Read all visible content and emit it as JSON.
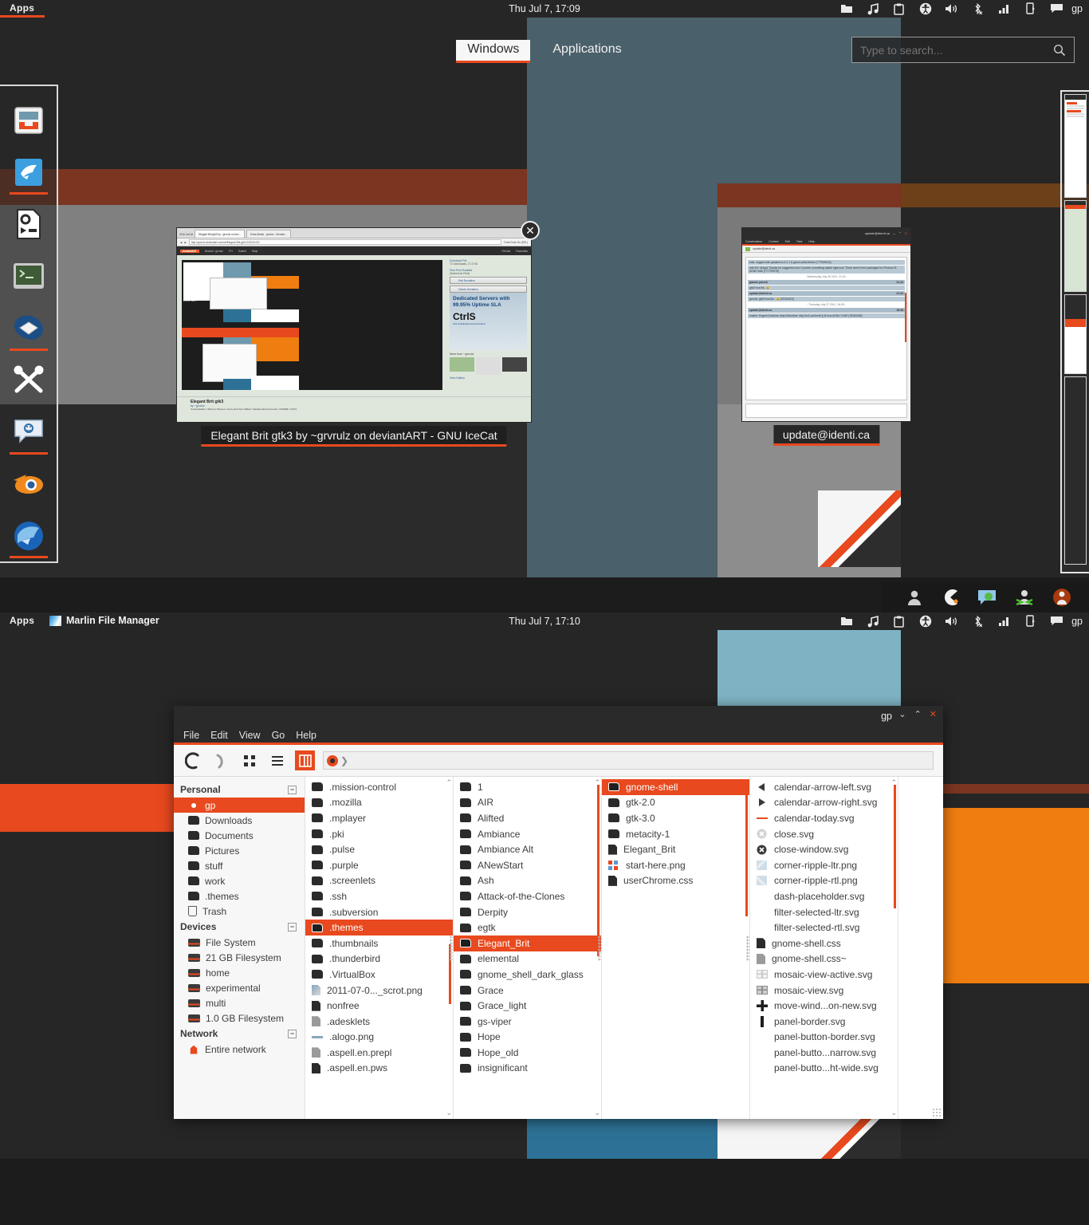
{
  "top_screen": {
    "panel": {
      "apps_label": "Apps",
      "clock": "Thu Jul 7, 17:09",
      "username": "gp",
      "tray_icons": [
        "folder-icon",
        "music-icon",
        "clipboard-icon",
        "accessibility-icon",
        "volume-icon",
        "bluetooth-disabled-icon",
        "signal-icon",
        "battery-icon",
        "chat-icon"
      ]
    },
    "overview": {
      "tabs": [
        {
          "label": "Windows",
          "active": true
        },
        {
          "label": "Applications",
          "active": false
        }
      ],
      "search_placeholder": "Type to search...",
      "search_value": "",
      "search_icon": "search-icon"
    },
    "dock": {
      "items": [
        {
          "name": "file-manager",
          "running": false
        },
        {
          "name": "icecat-browser",
          "running": true
        },
        {
          "name": "script-executor",
          "running": false
        },
        {
          "name": "terminal",
          "running": false
        },
        {
          "name": "thunderbird",
          "running": true
        },
        {
          "name": "xchat-scissors",
          "running": false
        },
        {
          "name": "empathy-chat",
          "running": true
        },
        {
          "name": "blender",
          "running": false
        },
        {
          "name": "firefox-blue",
          "running": true
        }
      ]
    },
    "window_previews": [
      {
        "label": "Elegant Brit gtk3 by ~grvrulz on deviantART - GNU IceCat",
        "has_close": true,
        "browser": {
          "app_tab": "GNU IceCat",
          "tabs": [
            "Elegant Brit gtk3 by ~grvrulz on dev...",
            "Extra Media - photos - Deviant..."
          ],
          "url": "http://grvrulz.deviantart.com/art/Elegant-Brit-gtk3-249412432",
          "search_engine": "Duck Duck Go (SSL)",
          "nav_items": [
            "deviantART",
            "Deviant ~grvrulz",
            "FYI",
            "Submit",
            "Shop"
          ],
          "nav_right": [
            "Friends",
            "Favourites"
          ],
          "side_links": [
            "Download File",
            "72 downloads, 27.2 KB",
            "Print Print Enabled",
            "(Submit as Print)"
          ],
          "side_buttons": [
            "Edit Deviation",
            "Delete Deviation"
          ],
          "ad_title": "Dedicated Servers with 99.95% Uptime SLA",
          "ad_brand": "CtrlS",
          "ad_sub1": "ctrls.in/dedicated-servers-india.in",
          "ad_sub2": "To Check Offer Click Here to Know",
          "ad_footer": "Ctrls.in Dedicated Hosting Servers",
          "more_from": "More from ~grvrulz",
          "gallery_link": "View Gallery",
          "art_title": "Elegant Brit gtk3",
          "art_by": "by ~grvrulz",
          "art_cats": "Customisation / Skins & Themes / Linux and Unix Utilities / Desktop Environments / GNOME / GTK3",
          "art_copy": "©2011 ~grvrulz",
          "art_caption": "free a..."
        }
      },
      {
        "label": "update@identi.ca",
        "has_close": false,
        "chat": {
          "title": "update@identi.ca",
          "menus": [
            "Conversation",
            "Contact",
            "Edit",
            "Tabs",
            "Help"
          ],
          "tab_label": "update@identi.ca",
          "messages": [
            {
              "type": "text",
              "body": "mks: oxygen-kde updated to 4.2.1 & gdm4-ar5ul firefox (777939042)"
            },
            {
              "type": "text",
              "body": "w4rr10r: @apol Thanks for suggestion but I'd prefer something stable right now. There aren't even packages for !Fedora 15 AFAIK !kde [777793978]"
            },
            {
              "type": "date",
              "body": "- Wednesday July 06 2011, 21:24 -"
            },
            {
              "type": "header",
              "from": "gaurav pareek",
              "time": "21:24"
            },
            {
              "type": "body",
              "body": "gtk3+css ftw.. 😃"
            },
            {
              "type": "header",
              "from": "update@identi.ca",
              "time": "21:24"
            },
            {
              "type": "body",
              "body": "grvrulz: gtk3+css ftw.. 😃 [78190023]"
            },
            {
              "type": "date",
              "body": "- Thursday July 07 2011, 16:28 -"
            },
            {
              "type": "header",
              "from": "update@identi.ca",
              "time": "16:28"
            },
            {
              "type": "body",
              "body": "malcer: Eugeni Dodonov deja !Mandriva: http://ur1.ca/4nnrb || #Linux #GNU ! KDE [78260280]"
            }
          ]
        }
      }
    ],
    "message_tray": [
      "contact-icon",
      "pacman-icon",
      "chat-green-icon",
      "person-star-icon",
      "user-circle-icon"
    ]
  },
  "bottom_screen": {
    "panel": {
      "apps_label": "Apps",
      "window_title": "Marlin File Manager",
      "clock": "Thu Jul 7, 17:10",
      "username": "gp"
    },
    "file_manager": {
      "title": "gp",
      "window_buttons": [
        "minimize",
        "maximize",
        "close"
      ],
      "menus": [
        "File",
        "Edit",
        "View",
        "Go",
        "Help"
      ],
      "toolbar": {
        "back_icon": "back-icon",
        "forward_icon": "forward-icon",
        "icon_view_icon": "grid-view-icon",
        "list_view_icon": "list-view-icon",
        "column_view_icon": "column-view-icon",
        "active_view": "column-view-icon"
      },
      "breadcrumb": "",
      "sidebar": [
        {
          "heading": "Personal",
          "collapsible": true,
          "items": [
            {
              "label": "gp",
              "icon": "home-icon",
              "selected": true
            },
            {
              "label": "Downloads",
              "icon": "folder-icon"
            },
            {
              "label": "Documents",
              "icon": "folder-icon"
            },
            {
              "label": "Pictures",
              "icon": "folder-icon"
            },
            {
              "label": "stuff",
              "icon": "folder-icon"
            },
            {
              "label": "work",
              "icon": "folder-icon"
            },
            {
              "label": ".themes",
              "icon": "folder-icon"
            },
            {
              "label": "Trash",
              "icon": "trash-icon"
            }
          ]
        },
        {
          "heading": "Devices",
          "collapsible": true,
          "items": [
            {
              "label": "File System",
              "icon": "drive-icon"
            },
            {
              "label": "21 GB Filesystem",
              "icon": "drive-icon"
            },
            {
              "label": "home",
              "icon": "drive-icon"
            },
            {
              "label": "experimental",
              "icon": "drive-icon"
            },
            {
              "label": "multi",
              "icon": "drive-icon"
            },
            {
              "label": "1.0 GB Filesystem",
              "icon": "drive-icon"
            }
          ]
        },
        {
          "heading": "Network",
          "collapsible": true,
          "items": [
            {
              "label": "Entire network",
              "icon": "network-icon"
            }
          ]
        }
      ],
      "columns": [
        {
          "name": "home-column",
          "items": [
            {
              "label": ".mission-control",
              "icon": "folder-icon"
            },
            {
              "label": ".mozilla",
              "icon": "folder-icon"
            },
            {
              "label": ".mplayer",
              "icon": "folder-icon"
            },
            {
              "label": ".pki",
              "icon": "folder-icon"
            },
            {
              "label": ".pulse",
              "icon": "folder-icon"
            },
            {
              "label": ".purple",
              "icon": "folder-icon"
            },
            {
              "label": ".screenlets",
              "icon": "folder-icon"
            },
            {
              "label": ".ssh",
              "icon": "folder-icon"
            },
            {
              "label": ".subversion",
              "icon": "folder-icon"
            },
            {
              "label": ".themes",
              "icon": "folder-icon",
              "selected": true
            },
            {
              "label": ".thumbnails",
              "icon": "folder-icon"
            },
            {
              "label": ".thunderbird",
              "icon": "folder-icon"
            },
            {
              "label": ".VirtualBox",
              "icon": "folder-icon"
            },
            {
              "label": "2011-07-0..._scrot.png",
              "icon": "image-icon"
            },
            {
              "label": "nonfree",
              "icon": "file-icon"
            },
            {
              "label": ".adesklets",
              "icon": "file-light-icon"
            },
            {
              "label": ".alogo.png",
              "icon": "image-small-icon"
            },
            {
              "label": ".aspell.en.prepl",
              "icon": "file-light-icon"
            },
            {
              "label": ".aspell.en.pws",
              "icon": "file-icon"
            }
          ]
        },
        {
          "name": "themes-column",
          "items": [
            {
              "label": "1",
              "icon": "folder-icon"
            },
            {
              "label": "AIR",
              "icon": "folder-icon"
            },
            {
              "label": "Alifted",
              "icon": "folder-icon"
            },
            {
              "label": "Ambiance",
              "icon": "folder-icon"
            },
            {
              "label": "Ambiance Alt",
              "icon": "folder-icon"
            },
            {
              "label": "ANewStart",
              "icon": "folder-icon"
            },
            {
              "label": "Ash",
              "icon": "folder-icon"
            },
            {
              "label": "Attack-of-the-Clones",
              "icon": "folder-icon"
            },
            {
              "label": "Derpity",
              "icon": "folder-icon"
            },
            {
              "label": "egtk",
              "icon": "folder-icon"
            },
            {
              "label": "Elegant_Brit",
              "icon": "folder-icon",
              "selected": true
            },
            {
              "label": "elemental",
              "icon": "folder-icon"
            },
            {
              "label": "gnome_shell_dark_glass",
              "icon": "folder-icon"
            },
            {
              "label": "Grace",
              "icon": "folder-icon"
            },
            {
              "label": "Grace_light",
              "icon": "folder-icon"
            },
            {
              "label": "gs-viper",
              "icon": "folder-icon"
            },
            {
              "label": "Hope",
              "icon": "folder-icon"
            },
            {
              "label": "Hope_old",
              "icon": "folder-icon"
            },
            {
              "label": "insignificant",
              "icon": "folder-icon"
            }
          ]
        },
        {
          "name": "elegant-brit-column",
          "items": [
            {
              "label": "gnome-shell",
              "icon": "folder-icon",
              "selected": true
            },
            {
              "label": "gtk-2.0",
              "icon": "folder-icon"
            },
            {
              "label": "gtk-3.0",
              "icon": "folder-icon"
            },
            {
              "label": "metacity-1",
              "icon": "folder-icon"
            },
            {
              "label": "Elegant_Brit",
              "icon": "file-icon"
            },
            {
              "label": "start-here.png",
              "icon": "image-color-icon"
            },
            {
              "label": "userChrome.css",
              "icon": "file-icon"
            }
          ]
        },
        {
          "name": "gnome-shell-column",
          "items": [
            {
              "label": "calendar-arrow-left.svg",
              "icon": "arrow-left-icon"
            },
            {
              "label": "calendar-arrow-right.svg",
              "icon": "arrow-right-icon"
            },
            {
              "label": "calendar-today.svg",
              "icon": "dash-icon"
            },
            {
              "label": "close.svg",
              "icon": "close-grey-icon"
            },
            {
              "label": "close-window.svg",
              "icon": "close-dark-icon"
            },
            {
              "label": "corner-ripple-ltr.png",
              "icon": "ripple-ltr-icon"
            },
            {
              "label": "corner-ripple-rtl.png",
              "icon": "ripple-rtl-icon"
            },
            {
              "label": "dash-placeholder.svg",
              "icon": "none"
            },
            {
              "label": "filter-selected-ltr.svg",
              "icon": "none"
            },
            {
              "label": "filter-selected-rtl.svg",
              "icon": "none"
            },
            {
              "label": "gnome-shell.css",
              "icon": "file-icon"
            },
            {
              "label": "gnome-shell.css~",
              "icon": "file-light-icon"
            },
            {
              "label": "mosaic-view-active.svg",
              "icon": "mosaic-active-icon"
            },
            {
              "label": "mosaic-view.svg",
              "icon": "mosaic-icon"
            },
            {
              "label": "move-wind...on-new.svg",
              "icon": "plus-icon"
            },
            {
              "label": "panel-border.svg",
              "icon": "bar-icon"
            },
            {
              "label": "panel-button-border.svg",
              "icon": "none"
            },
            {
              "label": "panel-butto...narrow.svg",
              "icon": "none"
            },
            {
              "label": "panel-butto...ht-wide.svg",
              "icon": "none"
            }
          ]
        }
      ]
    }
  },
  "colors": {
    "accent": "#e8491e",
    "panel_bg": "#262626",
    "wall_dark": "#262626",
    "wall_teal": "#4a606a",
    "wall_brown": "#7b3520",
    "wall_grey": "#808080",
    "wall_orange": "#ef7d10",
    "wall_blue": "#7fb3c4",
    "wall_steel": "#2d7296"
  }
}
